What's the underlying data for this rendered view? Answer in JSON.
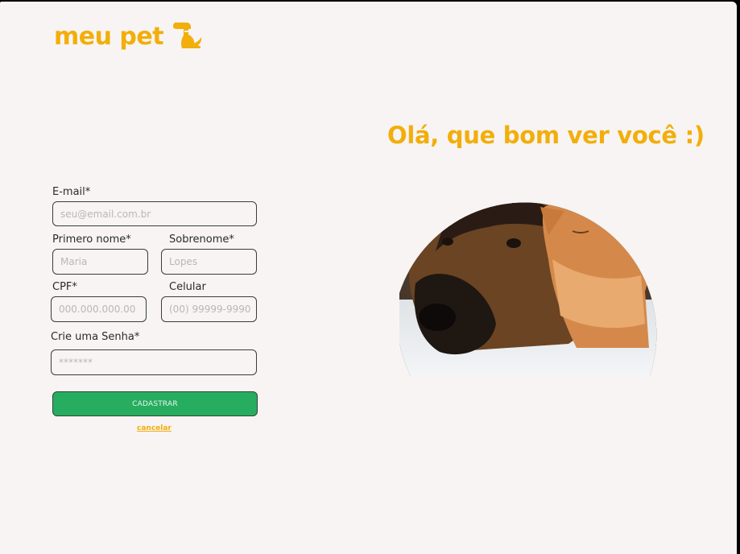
{
  "brand": {
    "name": "meu pet",
    "icon": "dog-icon",
    "color": "#f2ae0a"
  },
  "greeting": "Olá, que bom ver você :)",
  "form": {
    "email": {
      "label": "E-mail*",
      "placeholder": "seu@email.com.br"
    },
    "first_name": {
      "label": "Primero nome*",
      "placeholder": "Maria"
    },
    "last_name": {
      "label": "Sobrenome*",
      "placeholder": "Lopes"
    },
    "cpf": {
      "label": "CPF*",
      "placeholder": "000.000.000.00"
    },
    "phone": {
      "label": "Celular",
      "placeholder": "(00) 99999-9990"
    },
    "password": {
      "label": "Crie uma Senha*",
      "placeholder": "*******"
    },
    "submit_label": "CADASTRAR",
    "cancel_label": "cancelar"
  },
  "colors": {
    "accent": "#f2ae0a",
    "submit": "#27ad60",
    "background": "#f7f4f3"
  }
}
